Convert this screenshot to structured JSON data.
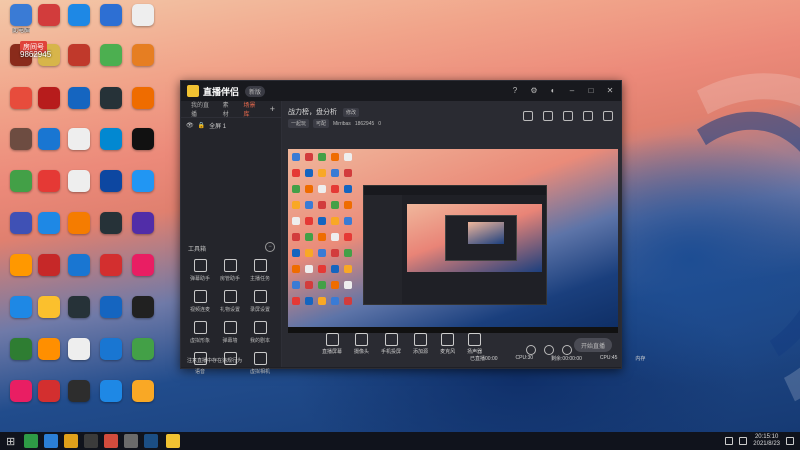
{
  "overlay": {
    "badge": "房间号",
    "room_id": "9862945"
  },
  "desktop_icons": [
    {
      "name": "computer",
      "label": "此电脑",
      "color": "#3a7bd5"
    },
    {
      "name": "netease",
      "label": "",
      "color": "#d23c3c"
    },
    {
      "name": "kuwo",
      "label": "",
      "color": "#1e88e5"
    },
    {
      "name": "settings",
      "label": "",
      "color": "#2d6fd3"
    },
    {
      "name": "file",
      "label": "",
      "color": "#eeeeee"
    },
    {
      "name": "game",
      "label": "",
      "color": "#8a2b1b"
    },
    {
      "name": "app7",
      "label": "",
      "color": "#d7b54a"
    },
    {
      "name": "app8",
      "label": "",
      "color": "#c0392b"
    },
    {
      "name": "app9",
      "label": "",
      "color": "#4caf50"
    },
    {
      "name": "app10",
      "label": "",
      "color": "#e67e22"
    },
    {
      "name": "app11",
      "label": "",
      "color": "#e74c3c"
    },
    {
      "name": "app12",
      "label": "",
      "color": "#b71c1c"
    },
    {
      "name": "app13",
      "label": "",
      "color": "#1565c0"
    },
    {
      "name": "app14",
      "label": "",
      "color": "#263238"
    },
    {
      "name": "app15",
      "label": "",
      "color": "#ef6c00"
    },
    {
      "name": "app16",
      "label": "",
      "color": "#6d4c41"
    },
    {
      "name": "app17",
      "label": "",
      "color": "#1976d2"
    },
    {
      "name": "app18",
      "label": "",
      "color": "#eeeeee"
    },
    {
      "name": "app19",
      "label": "",
      "color": "#0288d1"
    },
    {
      "name": "app20",
      "label": "",
      "color": "#111111"
    },
    {
      "name": "app21",
      "label": "",
      "color": "#43a047"
    },
    {
      "name": "app22",
      "label": "",
      "color": "#e53935"
    },
    {
      "name": "app23",
      "label": "",
      "color": "#eeeeee"
    },
    {
      "name": "app24",
      "label": "",
      "color": "#0d47a1"
    },
    {
      "name": "app25",
      "label": "",
      "color": "#2196f3"
    },
    {
      "name": "app26",
      "label": "",
      "color": "#3f51b5"
    },
    {
      "name": "app27",
      "label": "",
      "color": "#1e88e5"
    },
    {
      "name": "app28",
      "label": "",
      "color": "#f57c00"
    },
    {
      "name": "app29",
      "label": "",
      "color": "#263238"
    },
    {
      "name": "app30",
      "label": "",
      "color": "#512da8"
    },
    {
      "name": "app31",
      "label": "",
      "color": "#ff9800"
    },
    {
      "name": "app32",
      "label": "",
      "color": "#c62828"
    },
    {
      "name": "app33",
      "label": "",
      "color": "#1976d2"
    },
    {
      "name": "app34",
      "label": "",
      "color": "#d32f2f"
    },
    {
      "name": "app35",
      "label": "",
      "color": "#e91e63"
    },
    {
      "name": "app36",
      "label": "",
      "color": "#1e88e5"
    },
    {
      "name": "app37",
      "label": "",
      "color": "#fbc02d"
    },
    {
      "name": "app38",
      "label": "",
      "color": "#263238"
    },
    {
      "name": "app39",
      "label": "",
      "color": "#1565c0"
    },
    {
      "name": "app40",
      "label": "",
      "color": "#212121"
    },
    {
      "name": "app41",
      "label": "",
      "color": "#2e7d32"
    },
    {
      "name": "app42",
      "label": "",
      "color": "#ff8f00"
    },
    {
      "name": "app43",
      "label": "",
      "color": "#eeeeee"
    },
    {
      "name": "app44",
      "label": "",
      "color": "#1976d2"
    },
    {
      "name": "app45",
      "label": "",
      "color": "#43a047"
    },
    {
      "name": "app46",
      "label": "",
      "color": "#e91e63"
    },
    {
      "name": "app47",
      "label": "",
      "color": "#d32f2f"
    },
    {
      "name": "app48",
      "label": "",
      "color": "#2d2d2d"
    },
    {
      "name": "app49",
      "label": "",
      "color": "#1e88e5"
    },
    {
      "name": "app50",
      "label": "",
      "color": "#f9a825"
    },
    {
      "name": "app51",
      "label": "",
      "color": "#1565c0"
    },
    {
      "name": "app52",
      "label": "",
      "color": "#212121"
    },
    {
      "name": "app53",
      "label": "",
      "color": "#ef6c00"
    },
    {
      "name": "app54",
      "label": "",
      "color": "#0d47a1"
    },
    {
      "name": "app55",
      "label": "",
      "color": "#424242"
    },
    {
      "name": "app56",
      "label": "",
      "color": "#ff6f00"
    }
  ],
  "window": {
    "title": "直播伴侣",
    "badge": "新版",
    "tabs": [
      "我的直播",
      "素材",
      "场景库"
    ],
    "active_tab": "场景库",
    "scene": "全屏 1",
    "toolbox_title": "工具箱",
    "tools": [
      "弹幕助手",
      "房管助手",
      "主播任务",
      "视频连麦",
      "礼物设置",
      "录屏设置",
      "虚拟形象",
      "弹幕墙",
      "我的剧本",
      "语音",
      "",
      "虚拟相机"
    ],
    "notice": "注意直播中存在违规行为",
    "live_title": "战力榜，盘分析",
    "live_tag": "修改",
    "chips": [
      "一起玩",
      "可配"
    ],
    "room_label": "Mirribas",
    "room_no": "1862945",
    "likes": "0",
    "actions": [
      "直播屏幕",
      "摄像头",
      "手机投屏",
      "添加源",
      "麦克风",
      "扬声器"
    ],
    "start_button": "开始直播",
    "status": [
      "已直播00:00",
      "CPU:30",
      "剩余:00:00:00",
      "CPU:45",
      "内存"
    ]
  },
  "taskbar": {
    "time": "20:15:10",
    "date": "2021/8/23"
  }
}
